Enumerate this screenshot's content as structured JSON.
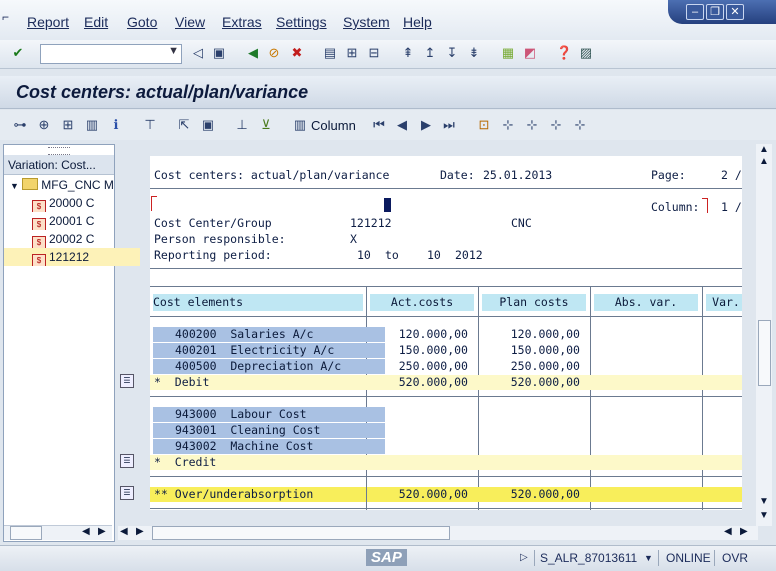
{
  "menu": {
    "items": [
      "Report",
      "Edit",
      "Goto",
      "View",
      "Extras",
      "Settings",
      "System",
      "Help"
    ]
  },
  "window_controls": {
    "minimize": "–",
    "restore": "❐",
    "close": "✕"
  },
  "standard_toolbar": {
    "command_field": ""
  },
  "title": "Cost centers: actual/plan/variance",
  "app_toolbar": {
    "column_label": "Column"
  },
  "tree": {
    "header": "Variation: Cost...",
    "root": "MFG_CNC M",
    "items": [
      "20000 C",
      "20001 C",
      "20002 C",
      "121212"
    ]
  },
  "report": {
    "title": "Cost centers: actual/plan/variance",
    "date_label": "Date:",
    "date": "25.01.2013",
    "page_label": "Page:",
    "page": "2 /",
    "column_label": "Column:",
    "column": "1 /",
    "cc_group_label": "Cost Center/Group",
    "cc_group_value": "121212",
    "cc_group_name": "CNC",
    "person_label": "Person responsible:",
    "person_value": "X",
    "period_label": "Reporting period:",
    "period_from": "10",
    "period_to_word": "to",
    "period_to": "10",
    "period_year": "2012",
    "columns": [
      "Cost elements",
      "Act.costs",
      "Plan costs",
      "Abs. var.",
      "Var."
    ],
    "debit_rows": [
      {
        "element": "400200  Salaries A/c",
        "act": "120.000,00",
        "plan": "120.000,00"
      },
      {
        "element": "400201  Electricity A/c",
        "act": "150.000,00",
        "plan": "150.000,00"
      },
      {
        "element": "400500  Depreciation A/c",
        "act": "250.000,00",
        "plan": "250.000,00"
      }
    ],
    "debit_total": {
      "label": "*  Debit",
      "act": "520.000,00",
      "plan": "520.000,00"
    },
    "credit_rows": [
      {
        "element": "943000  Labour Cost"
      },
      {
        "element": "943001  Cleaning Cost"
      },
      {
        "element": "943002  Machine Cost"
      }
    ],
    "credit_total": {
      "label": "*  Credit"
    },
    "over_under": {
      "label": "** Over/underabsorption",
      "act": "520.000,00",
      "plan": "520.000,00"
    }
  },
  "status": {
    "logo": "SAP",
    "transaction": "S_ALR_87013611",
    "mode": "ONLINE",
    "insert": "OVR"
  },
  "colors": {
    "header_cell": "#bfe7f3",
    "element_cell": "#a9c1e3",
    "subtotal": "#fdf9c9",
    "total": "#f8ee5b"
  }
}
